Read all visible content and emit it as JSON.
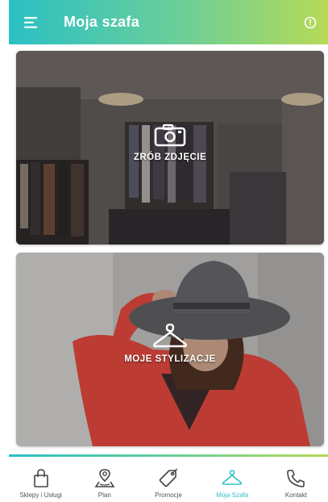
{
  "header": {
    "title": "Moja szafa",
    "gradient_start": "#2bc0c4",
    "gradient_end": "#b6da56"
  },
  "cards": [
    {
      "label": "ZRÓB ZDJĘCIE",
      "icon": "camera-icon"
    },
    {
      "label": "MOJE STYLIZACJE",
      "icon": "hanger-icon"
    }
  ],
  "bottom_nav": {
    "active_color": "#33bfc7",
    "items": [
      {
        "label": "Sklepy i Usługi",
        "icon": "shopping-bag-icon",
        "active": false
      },
      {
        "label": "Plan",
        "icon": "map-pin-icon",
        "active": false
      },
      {
        "label": "Promocje",
        "icon": "tag-icon",
        "active": false
      },
      {
        "label": "Moja Szafa",
        "icon": "hanger-icon",
        "active": true
      },
      {
        "label": "Kontakt",
        "icon": "phone-icon",
        "active": false
      }
    ]
  }
}
